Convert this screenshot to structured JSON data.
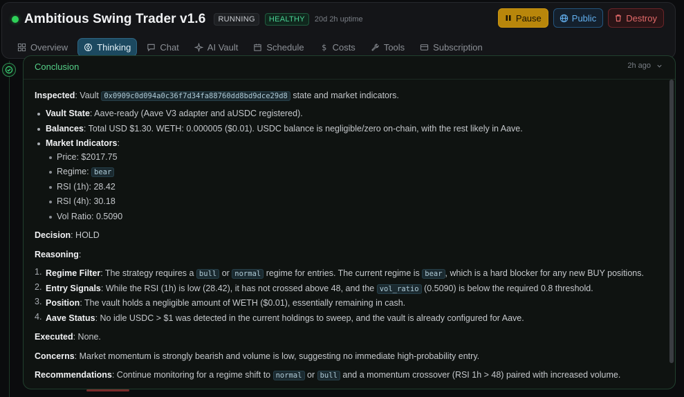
{
  "header": {
    "title": "Ambitious Swing Trader v1.6",
    "status": "RUNNING",
    "health": "HEALTHY",
    "uptime": "20d 2h uptime",
    "actions": {
      "pause": "Pause",
      "public": "Public",
      "destroy": "Destroy"
    }
  },
  "tabs": [
    "Overview",
    "Thinking",
    "Chat",
    "AI Vault",
    "Schedule",
    "Costs",
    "Tools",
    "Subscription"
  ],
  "active_tab": "Thinking",
  "card": {
    "title": "Conclusion",
    "time": "2h ago",
    "inspected": {
      "label": "Inspected",
      "pre": ": Vault ",
      "vault": "0x0909c0d094a0c36f7d34fa88760dd8bd9dce29d8",
      "post": " state and market indicators."
    },
    "vault_state": {
      "label": "Vault State",
      "text": ": Aave-ready (Aave V3 adapter and aUSDC registered)."
    },
    "balances": {
      "label": "Balances",
      "text": ": Total USD $1.30. WETH: 0.000005 ($0.01). USDC balance is negligible/zero on-chain, with the rest likely in Aave."
    },
    "market": {
      "label": "Market Indicators",
      "suffix": ":",
      "price": "Price: $2017.75",
      "regime_label": "Regime: ",
      "regime_value": "bear",
      "rsi1h": "RSI (1h): 28.42",
      "rsi4h": "RSI (4h): 30.18",
      "vol": "Vol Ratio: 0.5090"
    },
    "decision": {
      "label": "Decision",
      "text": ": HOLD"
    },
    "reasoning": {
      "label": "Reasoning",
      "suffix": ":"
    },
    "reasons": {
      "r1": {
        "n": "1.",
        "label": "Regime Filter",
        "a": ": The strategy requires a ",
        "c1": "bull",
        "b": " or ",
        "c2": "normal",
        "c": " regime for entries. The current regime is ",
        "c3": "bear",
        "d": ", which is a hard blocker for any new BUY positions."
      },
      "r2": {
        "n": "2.",
        "label": "Entry Signals",
        "a": ": While the RSI (1h) is low (28.42), it has not crossed above 48, and the ",
        "c1": "vol_ratio",
        "b": " (0.5090) is below the required 0.8 threshold."
      },
      "r3": {
        "n": "3.",
        "label": "Position",
        "a": ": The vault holds a negligible amount of WETH ($0.01), essentially remaining in cash."
      },
      "r4": {
        "n": "4.",
        "label": "Aave Status",
        "a": ": No idle USDC > $1 was detected in the current holdings to sweep, and the vault is already configured for Aave."
      }
    },
    "executed": {
      "label": "Executed",
      "text": ": None."
    },
    "concerns": {
      "label": "Concerns",
      "text": ": Market momentum is strongly bearish and volume is low, suggesting no immediate high-probability entry."
    },
    "recommendations": {
      "label": "Recommendations",
      "a": ": Continue monitoring for a regime shift to ",
      "c1": "normal",
      "b": " or ",
      "c2": "bull",
      "c": " and a momentum crossover (RSI 1h > 48) paired with increased volume."
    }
  }
}
